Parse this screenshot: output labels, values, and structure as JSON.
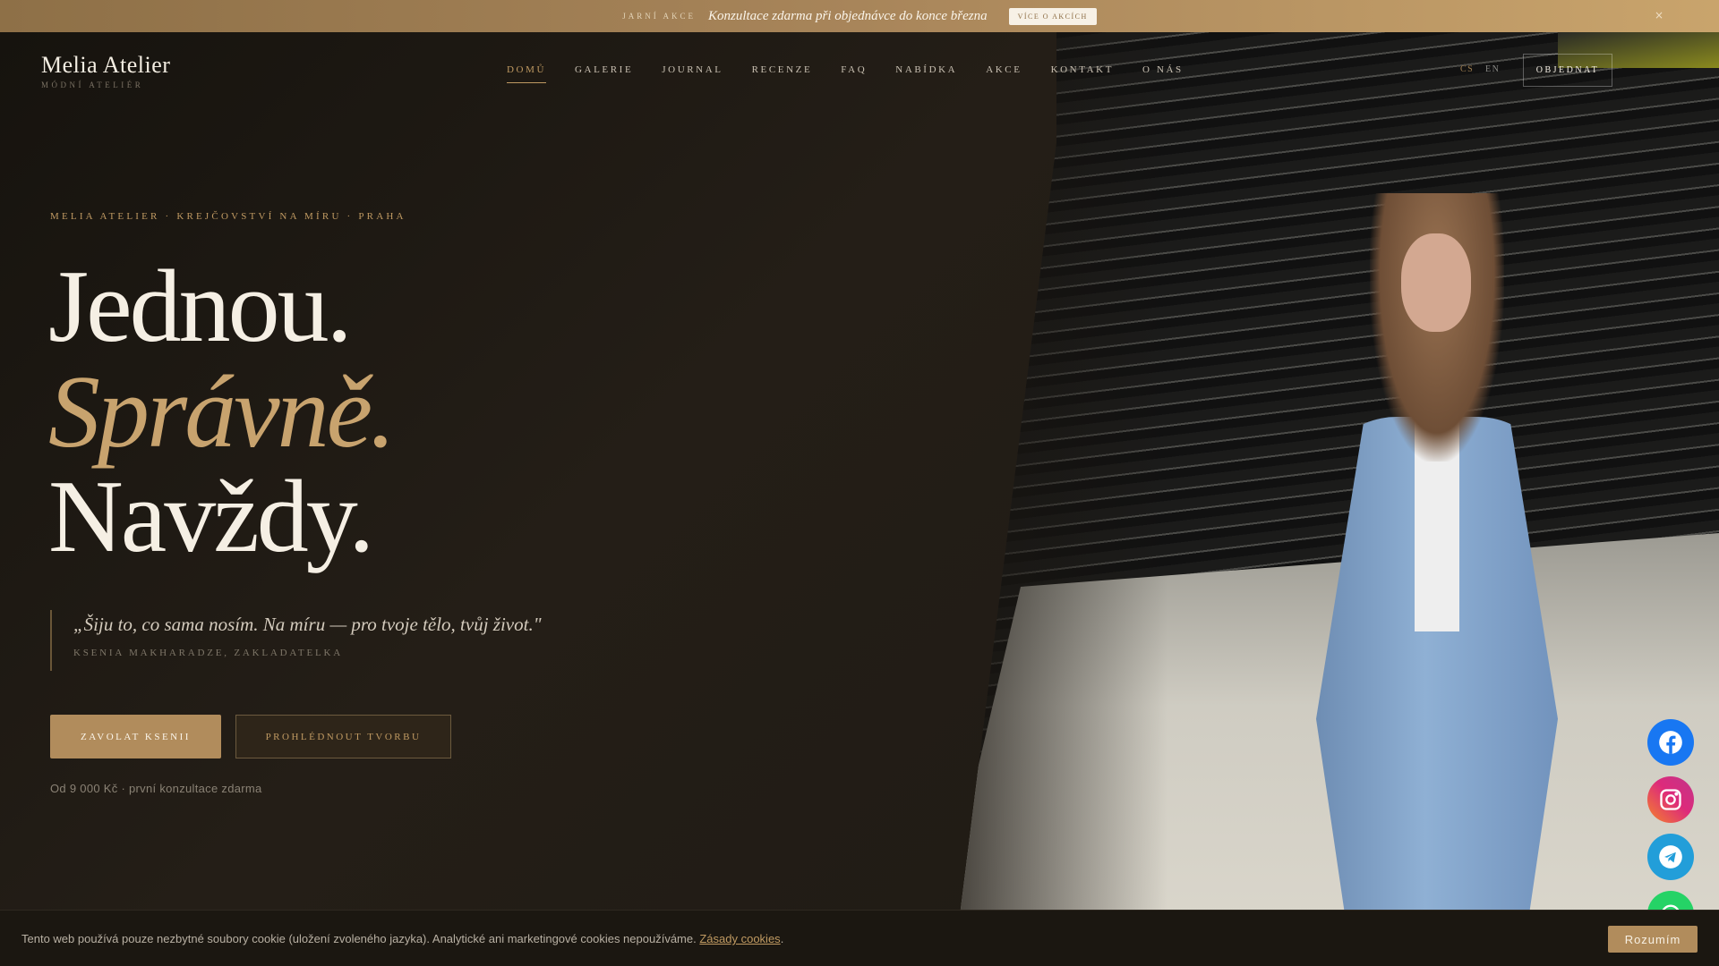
{
  "banner": {
    "label": "JARNÍ AKCE",
    "message": "Konzultace zdarma při objednávce do konce března",
    "button": "VÍCE O AKCÍCH",
    "close": "×"
  },
  "header": {
    "logo_title": "Melia Atelier",
    "logo_subtitle": "MÓDNÍ ATELIÉR",
    "nav": [
      {
        "label": "DOMŮ",
        "active": true
      },
      {
        "label": "GALERIE"
      },
      {
        "label": "JOURNAL"
      },
      {
        "label": "RECENZE"
      },
      {
        "label": "FAQ"
      },
      {
        "label": "NABÍDKA"
      },
      {
        "label": "AKCE"
      },
      {
        "label": "KONTAKT"
      },
      {
        "label": "O NÁS"
      }
    ],
    "languages": [
      "CS",
      "EN"
    ],
    "active_language": "CS",
    "order_button": "OBJEDNAT"
  },
  "hero": {
    "tagline": "MELIA ATELIER · KREJČOVSTVÍ NA MÍRU · PRAHA",
    "line1": "Jednou.",
    "line2": "Správně.",
    "line3": "Navždy.",
    "quote": "„Šiju to, co sama nosím. Na míru — pro tvoje tělo, tvůj život.\"",
    "quote_author": "KSENIA MAKHARADZE, ZAKLADATELKA",
    "primary_button": "ZAVOLAT KSENII",
    "secondary_button": "PROHLÉDNOUT TVORBU",
    "price_note": "Od 9 000 Kč · první konzultace zdarma"
  },
  "social": [
    {
      "name": "facebook",
      "color": "#1877f2"
    },
    {
      "name": "instagram",
      "color": "#d62976"
    },
    {
      "name": "telegram",
      "color": "#229ed9"
    },
    {
      "name": "whatsapp",
      "color": "#25d366"
    }
  ],
  "cookie": {
    "text": "Tento web používá pouze nezbytné soubory cookie (uložení zvoleného jazyka). Analytické ani marketingové cookies nepoužíváme.",
    "link": "Zásady cookies",
    "after": ".",
    "accept": "Rozumím"
  }
}
